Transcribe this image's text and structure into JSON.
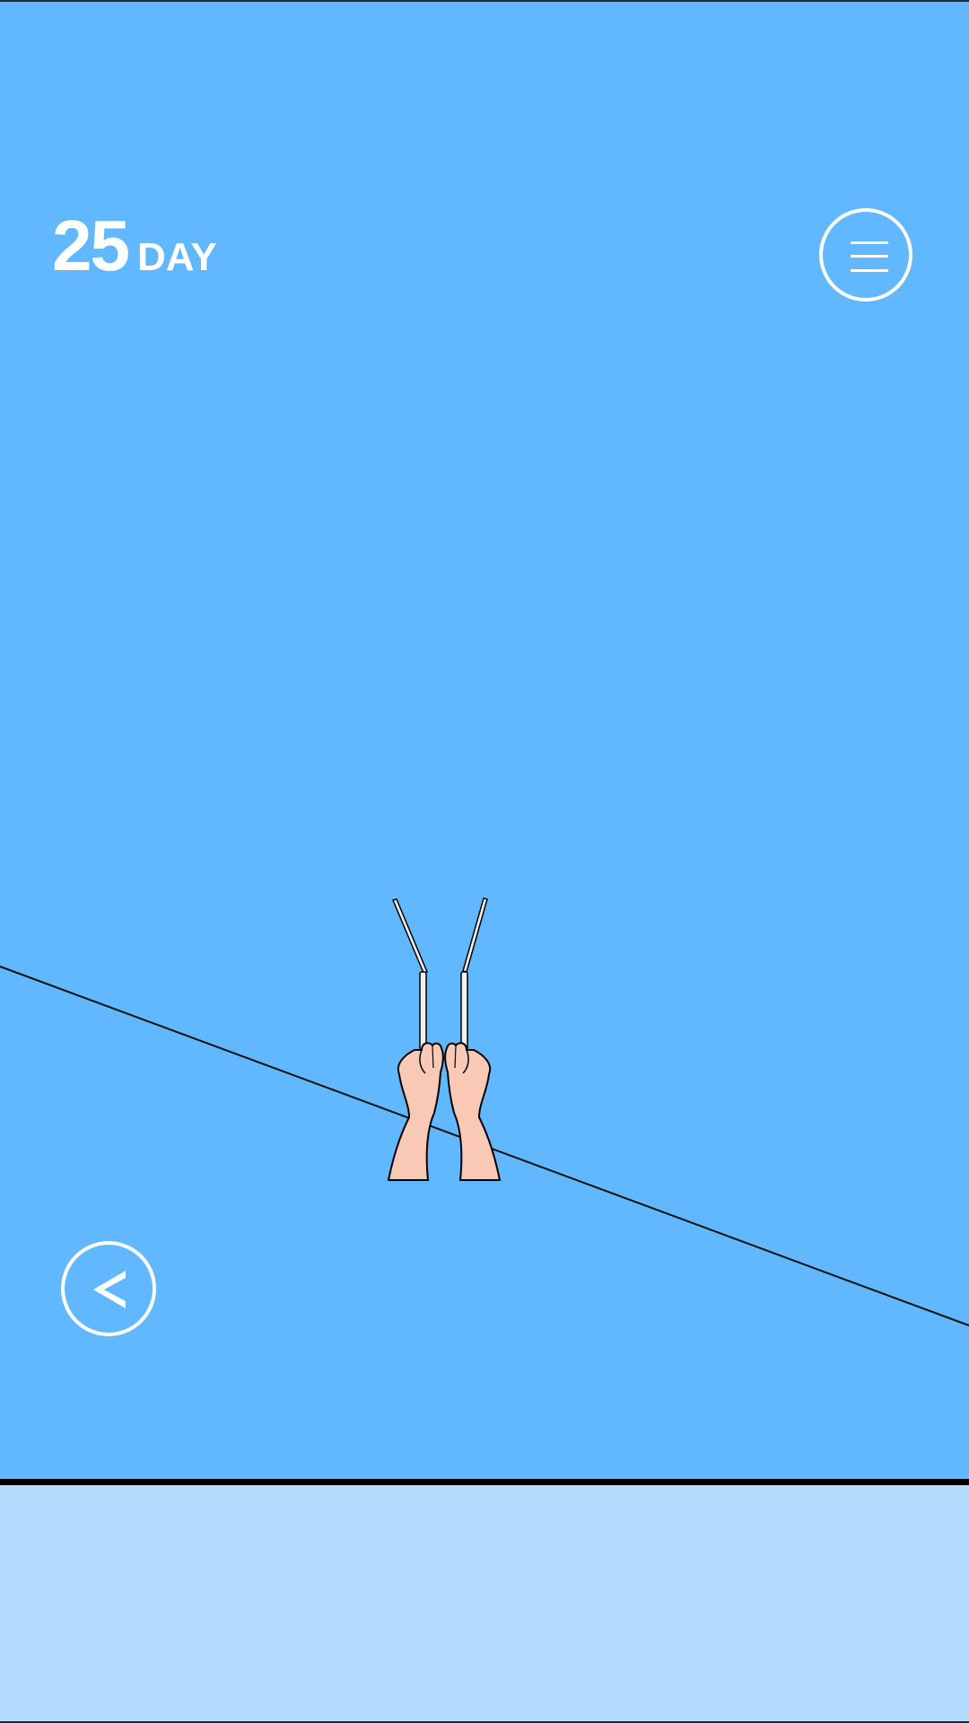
{
  "hud": {
    "day_number": "25",
    "day_unit": "DAY"
  },
  "icons": {
    "menu": "hamburger-menu-icon",
    "back": "chevron-left-icon"
  },
  "colors": {
    "sky": "#62b8ff",
    "bottom_panel": "#b3dcff",
    "ui_white": "#ffffff",
    "skin": "#f9c9b6",
    "outline": "#000000"
  }
}
